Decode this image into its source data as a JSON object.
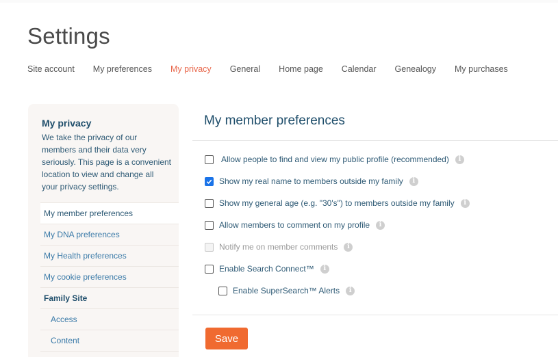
{
  "page": {
    "title": "Settings"
  },
  "tabs": [
    {
      "label": "Site account",
      "active": false
    },
    {
      "label": "My preferences",
      "active": false
    },
    {
      "label": "My privacy",
      "active": true
    },
    {
      "label": "General",
      "active": false
    },
    {
      "label": "Home page",
      "active": false
    },
    {
      "label": "Calendar",
      "active": false
    },
    {
      "label": "Genealogy",
      "active": false
    },
    {
      "label": "My purchases",
      "active": false
    }
  ],
  "sidebar": {
    "title": "My privacy",
    "description": "We take the privacy of our members and their data very seriously. This page is a convenient location to view and change all your privacy settings.",
    "items": [
      {
        "label": "My member preferences",
        "type": "link",
        "active": true
      },
      {
        "label": "My DNA preferences",
        "type": "link",
        "active": false
      },
      {
        "label": "My Health preferences",
        "type": "link",
        "active": false
      },
      {
        "label": "My cookie preferences",
        "type": "link",
        "active": false
      },
      {
        "label": "Family Site",
        "type": "header",
        "active": false
      },
      {
        "label": "Access",
        "type": "sub",
        "active": false
      },
      {
        "label": "Content",
        "type": "sub",
        "active": false
      }
    ]
  },
  "main": {
    "title": "My member preferences",
    "options": [
      {
        "label": "Allow people to find and view my public profile (recommended)",
        "checked": false,
        "disabled": false,
        "info_icon": "info-icon"
      },
      {
        "label": "Show my real name to members outside my family",
        "checked": true,
        "disabled": false,
        "info_icon": "info-icon"
      },
      {
        "label": "Show my general age (e.g. \"30's\") to members outside my family",
        "checked": false,
        "disabled": false,
        "info_icon": "info-icon"
      },
      {
        "label": "Allow members to comment on my profile",
        "checked": false,
        "disabled": false,
        "info_icon": "info-icon"
      },
      {
        "label": "Notify me on member comments",
        "checked": false,
        "disabled": true,
        "info_icon": "info-icon"
      },
      {
        "label": "Enable Search Connect™",
        "checked": false,
        "disabled": false,
        "info_icon": "info-icon"
      },
      {
        "label": "Enable SuperSearch™ Alerts",
        "checked": false,
        "disabled": false,
        "info_icon": "info-icon"
      }
    ],
    "info_glyph": "i",
    "save_label": "Save"
  },
  "colors": {
    "accent": "#e8664a",
    "save_button": "#f06a30",
    "heading_blue": "#1f4e6b",
    "link_blue": "#3a7aa8",
    "checkbox_checked": "#1a73e8",
    "sidebar_bg": "#f9f6f4"
  }
}
